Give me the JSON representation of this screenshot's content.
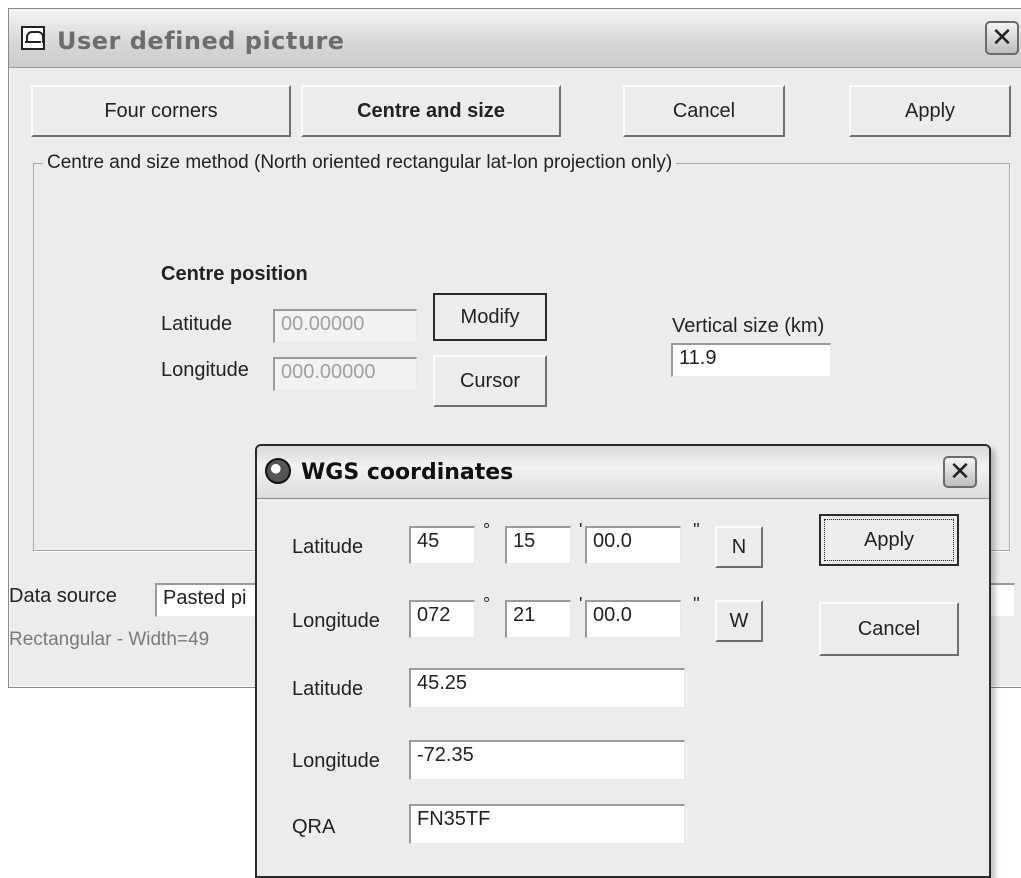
{
  "main_window": {
    "title": "User defined picture",
    "close_glyph": "✕",
    "buttons": {
      "four_corners": "Four corners",
      "centre_and_size": "Centre and size",
      "cancel": "Cancel",
      "apply": "Apply"
    },
    "group_title": "Centre and size method (North oriented rectangular lat-lon projection only)",
    "centre_position": {
      "heading": "Centre position",
      "latitude_label": "Latitude",
      "latitude_value": "00.00000",
      "longitude_label": "Longitude",
      "longitude_value": "000.00000",
      "modify_label": "Modify",
      "cursor_label": "Cursor"
    },
    "vertical_size": {
      "label": "Vertical size (km)",
      "value": "11.9"
    },
    "data_source": {
      "label": "Data source",
      "value": "Pasted pi"
    },
    "status_text": "Rectangular - Width=49"
  },
  "wgs_dialog": {
    "title": "WGS coordinates",
    "close_glyph": "✕",
    "latitude_dms": {
      "label": "Latitude",
      "degrees": "45",
      "minutes": "15",
      "seconds": "00.0",
      "hemisphere": "N"
    },
    "longitude_dms": {
      "label": "Longitude",
      "degrees": "072",
      "minutes": "21",
      "seconds": "00.0",
      "hemisphere": "W"
    },
    "unit_marks": {
      "degree": "°",
      "minute": "'",
      "second": "''"
    },
    "latitude_decimal": {
      "label": "Latitude",
      "value": "45.25"
    },
    "longitude_decimal": {
      "label": "Longitude",
      "value": "-72.35"
    },
    "qra": {
      "label": "QRA",
      "value": "FN35TF"
    },
    "apply_label": "Apply",
    "cancel_label": "Cancel"
  }
}
